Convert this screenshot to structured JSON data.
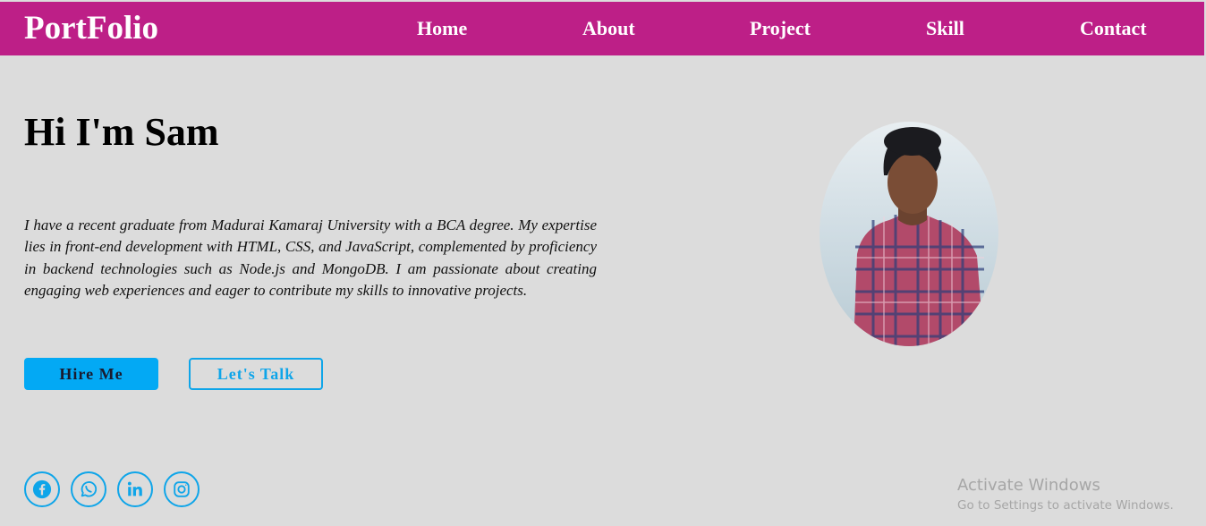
{
  "navbar": {
    "logo": "PortFolio",
    "links": [
      "Home",
      "About",
      "Project",
      "Skill",
      "Contact"
    ],
    "bg_color": "#bd1f87"
  },
  "hero": {
    "title": "Hi I'm Sam",
    "description": "I have a recent graduate from Madurai Kamaraj University with a BCA degree. My expertise lies in front-end development with HTML, CSS, and JavaScript, complemented by proficiency in backend technologies such as Node.js and MongoDB. I am passionate about creating engaging web experiences and eager to contribute my skills to innovative projects.",
    "hire_button": "Hire Me",
    "talk_button": "Let's Talk",
    "accent_color": "#03a9f4"
  },
  "social": {
    "icons": [
      "facebook-icon",
      "whatsapp-icon",
      "linkedin-icon",
      "instagram-icon"
    ]
  },
  "watermark": {
    "title": "Activate Windows",
    "subtitle": "Go to Settings to activate Windows."
  }
}
